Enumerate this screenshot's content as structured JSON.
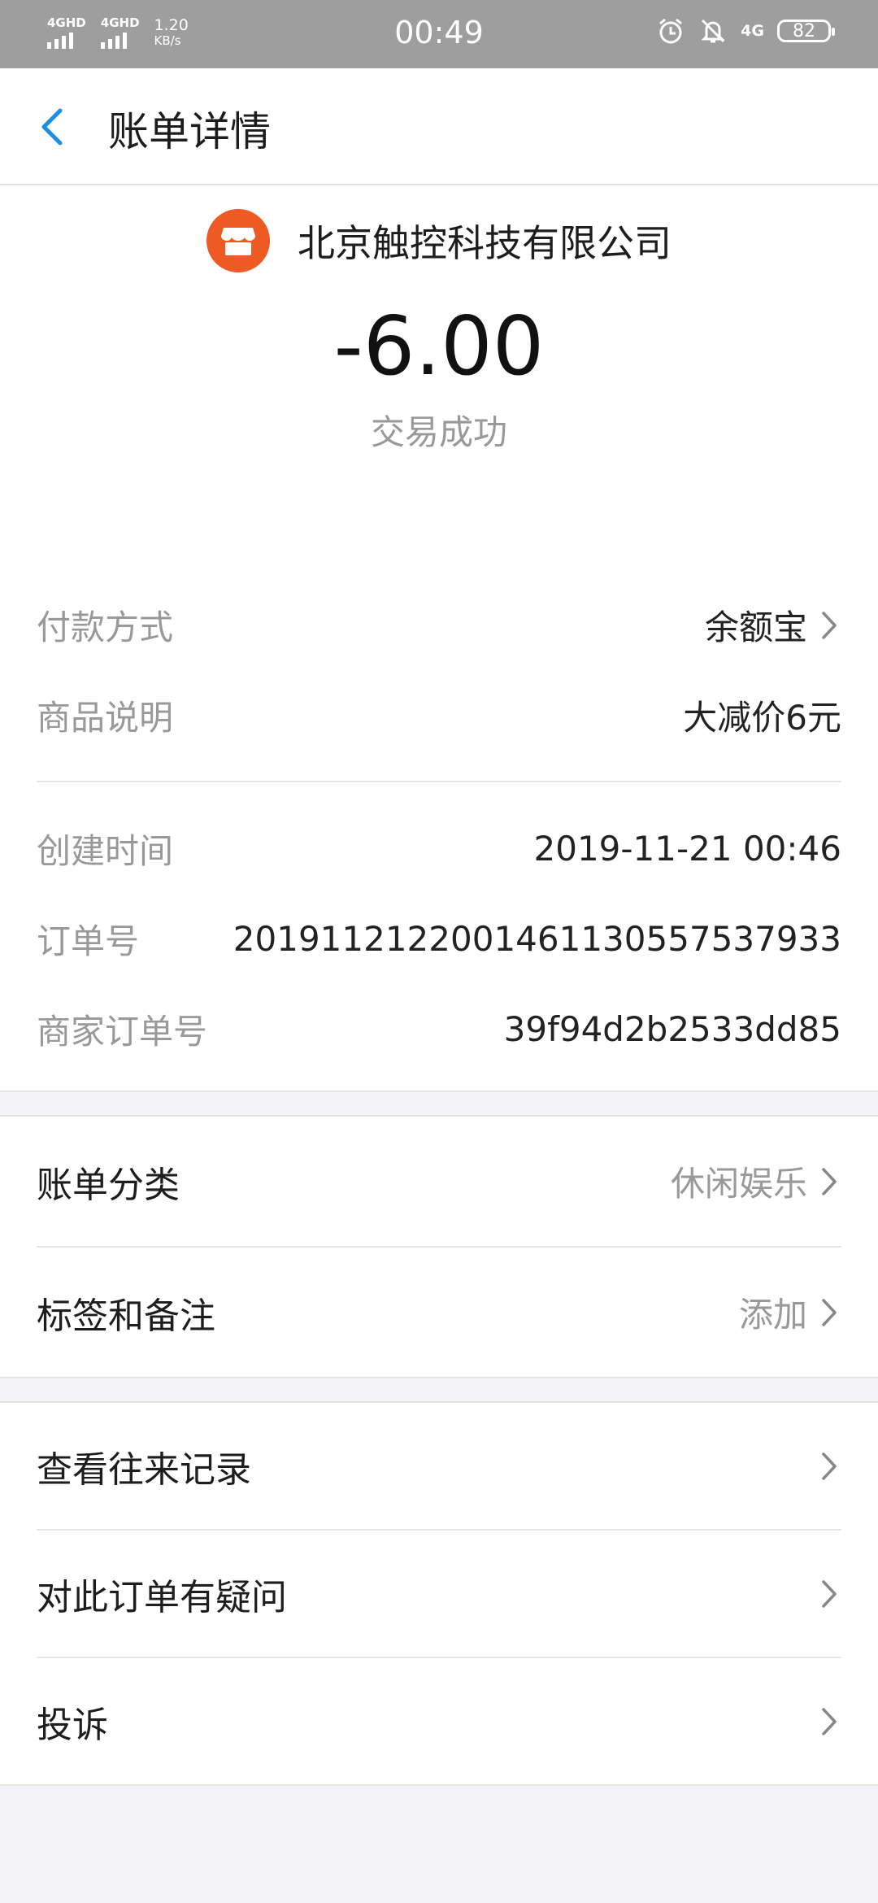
{
  "status_bar": {
    "signal1_label": "4GHD",
    "signal2_label": "4GHD",
    "speed_value": "1.20",
    "speed_unit": "KB/s",
    "time": "00:49",
    "network_label": "4G",
    "battery": "82"
  },
  "nav": {
    "title": "账单详情"
  },
  "merchant": {
    "name": "北京触控科技有限公司",
    "logo_icon": "store-icon",
    "logo_color": "#ee5a24"
  },
  "transaction": {
    "amount": "-6.00",
    "status": "交易成功"
  },
  "details": {
    "payment_method": {
      "label": "付款方式",
      "value": "余额宝"
    },
    "product_desc": {
      "label": "商品说明",
      "value": "大减价6元"
    },
    "created_time": {
      "label": "创建时间",
      "value": "2019-11-21 00:46"
    },
    "order_no": {
      "label": "订单号",
      "value": "2019112122001461130557537933"
    },
    "merchant_order_no": {
      "label": "商家订单号",
      "value": "39f94d2b2533dd85"
    }
  },
  "settings": {
    "category": {
      "label": "账单分类",
      "value": "休闲娱乐"
    },
    "tags": {
      "label": "标签和备注",
      "value": "添加"
    }
  },
  "actions": {
    "history": "查看往来记录",
    "question": "对此订单有疑问",
    "complaint": "投诉"
  },
  "colors": {
    "accent": "#1a8fe3",
    "brand_orange": "#ee5a24"
  }
}
